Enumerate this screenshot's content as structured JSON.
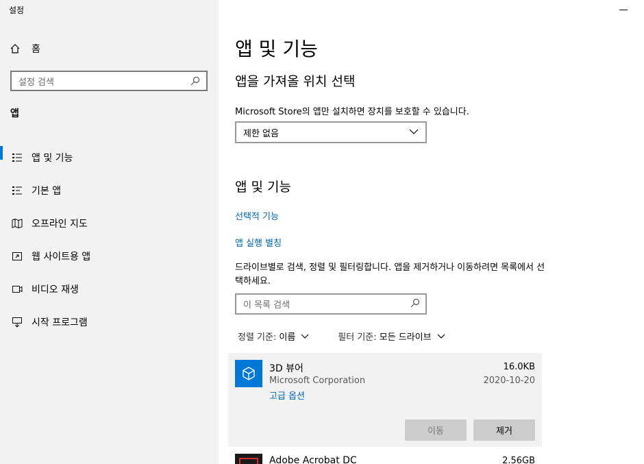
{
  "window": {
    "title": "설정"
  },
  "sidebar": {
    "home_label": "홈",
    "search_placeholder": "설정 검색",
    "section_title": "앱",
    "items": [
      {
        "label": "앱 및 기능",
        "icon": "apps-features-icon",
        "active": true
      },
      {
        "label": "기본 앱",
        "icon": "default-apps-icon",
        "active": false
      },
      {
        "label": "오프라인 지도",
        "icon": "offline-maps-icon",
        "active": false
      },
      {
        "label": "웹 사이트용 앱",
        "icon": "apps-for-websites-icon",
        "active": false
      },
      {
        "label": "비디오 재생",
        "icon": "video-playback-icon",
        "active": false
      },
      {
        "label": "시작 프로그램",
        "icon": "startup-icon",
        "active": false
      }
    ]
  },
  "main": {
    "page_title": "앱 및 기능",
    "install_section": {
      "title": "앱을 가져올 위치 선택",
      "description": "Microsoft Store의 앱만 설치하면 장치를 보호할 수 있습니다.",
      "selected_option": "제한 없음"
    },
    "apps_section": {
      "title": "앱 및 기능",
      "link_optional_features": "선택적 기능",
      "link_app_aliases": "앱 실행 별칭",
      "description": "드라이브별로 검색, 정렬 및 필터링합니다. 앱을 제거하거나 이동하려면 목록에서 선택하세요.",
      "search_placeholder": "이 목록 검색",
      "sort_label": "정렬 기준:",
      "sort_value": "이름",
      "filter_label": "필터 기준:",
      "filter_value": "모든 드라이브"
    },
    "apps": [
      {
        "name": "3D 뷰어",
        "publisher": "Microsoft Corporation",
        "advanced_link": "고급 옵션",
        "size": "16.0KB",
        "date": "2020-10-20",
        "move_label": "이동",
        "remove_label": "제거"
      },
      {
        "name": "Adobe Acrobat DC",
        "size": "2.56GB"
      }
    ]
  },
  "colors": {
    "accent": "#0078d7",
    "link": "#0067b8",
    "sidebar_bg": "#f2f2f2"
  }
}
